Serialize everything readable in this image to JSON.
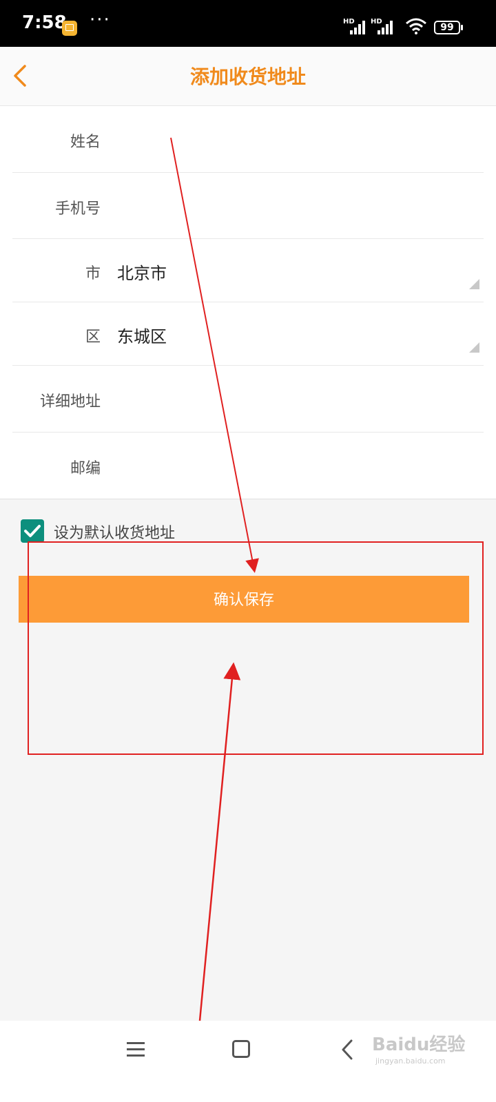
{
  "status_bar": {
    "time": "7:58",
    "more": "···",
    "signal_1_label": "HD",
    "signal_2_label": "HD",
    "battery": "99"
  },
  "header": {
    "title": "添加收货地址"
  },
  "form": {
    "name_label": "姓名",
    "phone_label": "手机号",
    "city_label": "市",
    "city_value": "北京市",
    "district_label": "区",
    "district_value": "东城区",
    "address_label": "详细地址",
    "postcode_label": "邮编"
  },
  "default_address": {
    "label": "设为默认收货地址",
    "checked": true
  },
  "confirm_button": {
    "label": "确认保存"
  },
  "watermark": {
    "text": "Baidu经验",
    "sub": "jingyan.baidu.com"
  },
  "colors": {
    "accent": "#f08a1c",
    "button": "#fd9b37",
    "checkbox": "#0d8f7d",
    "annotation": "#e02020"
  }
}
